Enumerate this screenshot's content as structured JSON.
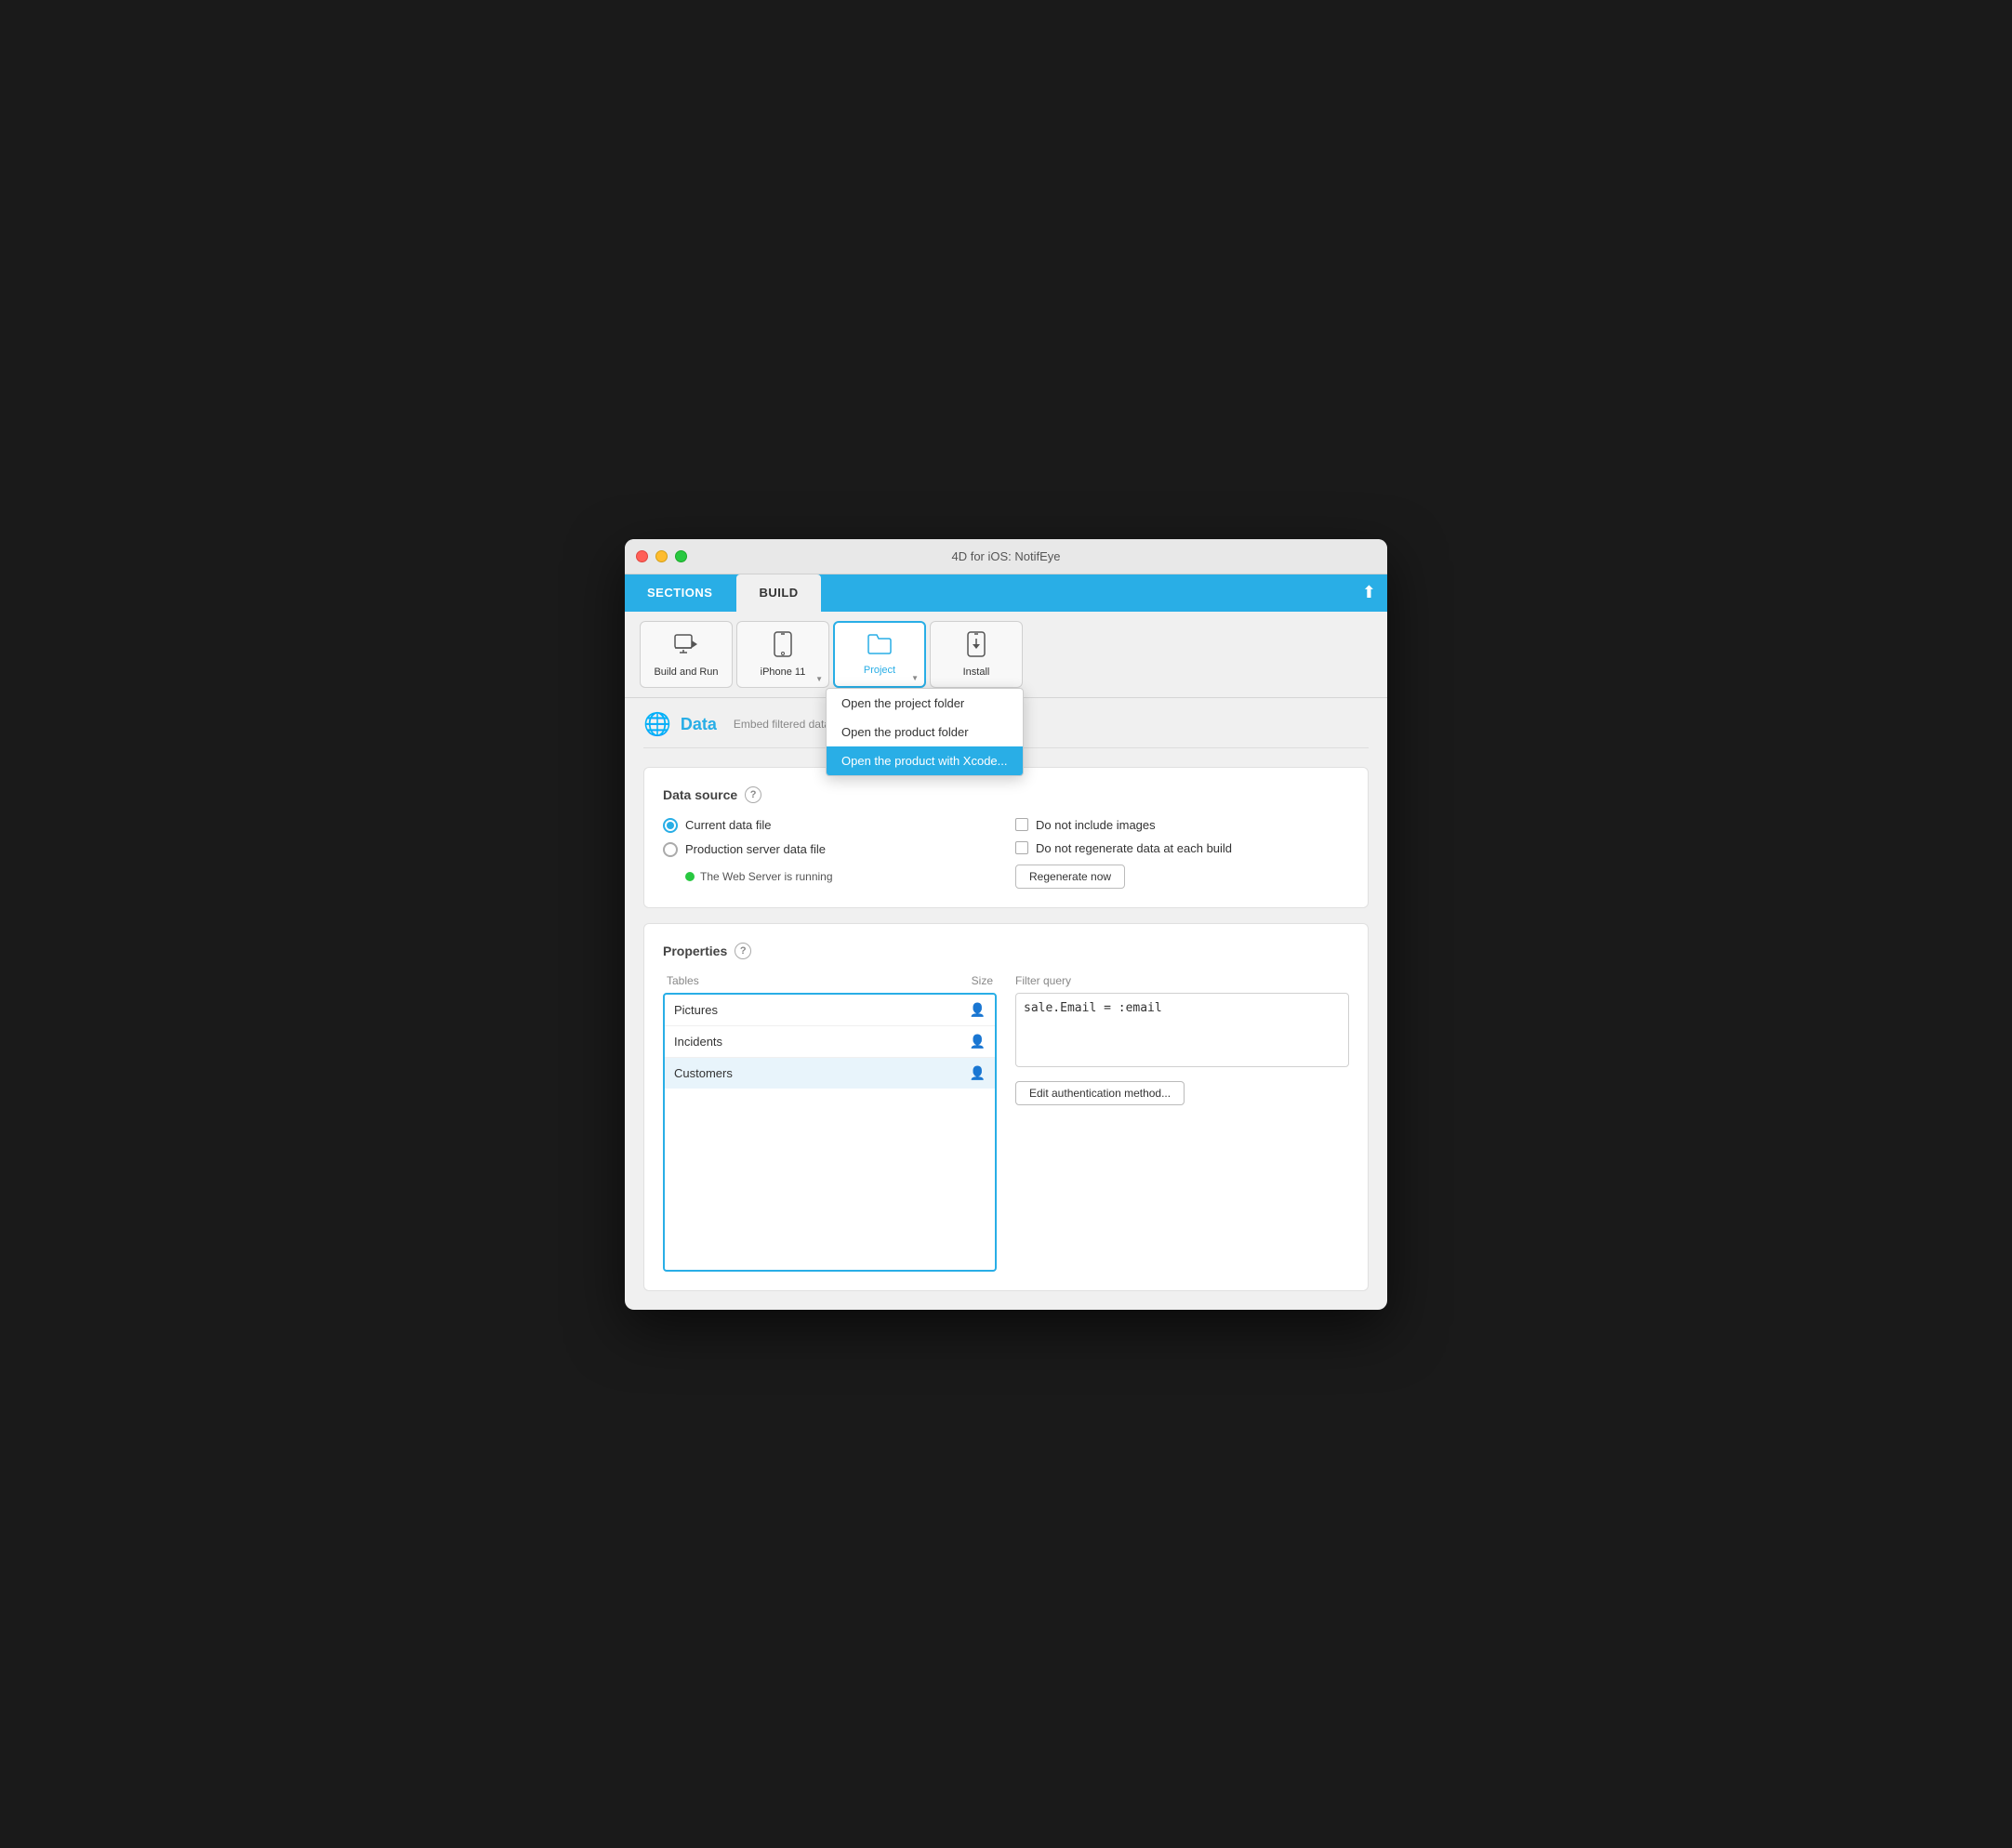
{
  "window": {
    "title": "4D for iOS: NotifEye"
  },
  "tabbar": {
    "sections_label": "SECTIONS",
    "build_label": "BUILD"
  },
  "toolbar": {
    "build_and_run_label": "Build and Run",
    "iphone_label": "iPhone 11",
    "project_label": "Project",
    "install_label": "Install"
  },
  "dropdown": {
    "items": [
      {
        "label": "Open the project folder",
        "selected": false
      },
      {
        "label": "Open the product folder",
        "selected": false
      },
      {
        "label": "Open the product with Xcode...",
        "selected": true
      }
    ]
  },
  "data_section": {
    "title": "Data",
    "description": "Embed filtered data fo",
    "data_source_title": "Data source",
    "current_data_file_label": "Current data file",
    "production_server_label": "Production server data file",
    "server_status_label": "The Web Server is running",
    "do_not_include_images_label": "Do not include images",
    "do_not_regenerate_label": "Do not regenerate data at each build",
    "regenerate_now_label": "Regenerate now"
  },
  "properties": {
    "title": "Properties",
    "tables_col": "Tables",
    "size_col": "Size",
    "tables": [
      {
        "name": "Pictures",
        "selected": false
      },
      {
        "name": "Incidents",
        "selected": false
      },
      {
        "name": "Customers",
        "selected": true
      }
    ],
    "filter_query_label": "Filter query",
    "filter_query_value": "sale.Email = :email",
    "edit_auth_label": "Edit authentication method..."
  },
  "icons": {
    "globe": "🌐",
    "build_and_run": "↺",
    "iphone": "📱",
    "project": "📁",
    "install": "⬇",
    "upload": "⬆",
    "person": "👤"
  }
}
